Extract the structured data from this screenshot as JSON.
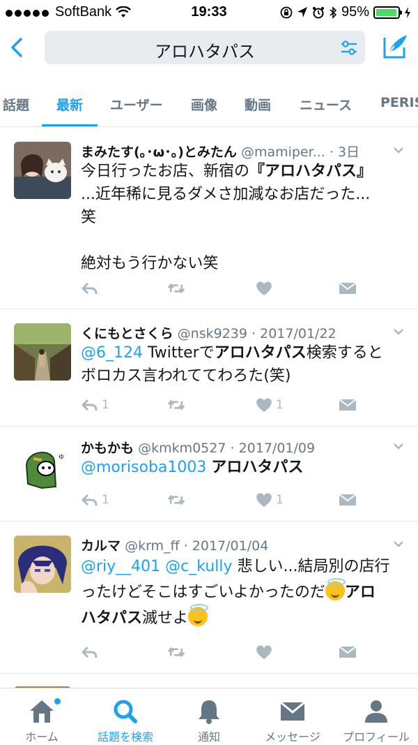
{
  "status_bar": {
    "carrier": "SoftBank",
    "time": "19:33",
    "battery": "95%",
    "battery_level": 0.95,
    "battery_color": "#4cd964"
  },
  "header": {
    "back_icon": "chevron-left-icon",
    "search_query": "アロハタパス",
    "filter_icon": "filter-sliders-icon",
    "compose_icon": "compose-tweet-icon"
  },
  "tabs": [
    {
      "label": "話題",
      "active": false
    },
    {
      "label": "最新",
      "active": true
    },
    {
      "label": "ユーザー",
      "active": false
    },
    {
      "label": "画像",
      "active": false
    },
    {
      "label": "動画",
      "active": false
    },
    {
      "label": "ニュース",
      "active": false
    },
    {
      "label": "PERIS",
      "active": false
    }
  ],
  "accent_color": "#1da1f2",
  "tweets": [
    {
      "name": "まみたす(｡･ω･｡)とみたん",
      "handle": "@mamiper...",
      "time": "· 3日",
      "text_lines": [
        "今日行ったお店、新宿の",
        "『アロハタパス』",
        "...近年稀に見るダメさ加減なお店だった...",
        "笑",
        "絶対もう行かない笑"
      ],
      "reply_count": "",
      "like_count": ""
    },
    {
      "name": "くにもとさくら",
      "handle": "@nsk9239",
      "time": "· 2017/01/22",
      "mention": "@6_124",
      "text_a": " Twitterで",
      "bold": "アロハタパス",
      "text_b": "検索すると",
      "text_line2": "ボロカス言われててわろた(笑)",
      "reply_count": "1",
      "like_count": "1"
    },
    {
      "name": "かもかも",
      "handle": "@kmkm0527",
      "time": "· 2017/01/09",
      "mention": "@morisoba1003",
      "bold": "アロハタパス",
      "reply_count": "1",
      "like_count": "1"
    },
    {
      "name": "カルマ",
      "handle": "@krm_ff",
      "time": "· 2017/01/04",
      "mention1": "@riy__401",
      "mention2": "@c_kully",
      "text_a": " 悲しい...結局別の店行",
      "text_b": "ったけどそこはすごいよかったのだ",
      "bold_a": "アロ",
      "bold_b": "ハタパス",
      "text_c": "滅せよ",
      "reply_count": "",
      "like_count": ""
    }
  ],
  "tab_bar": [
    {
      "label": "ホーム",
      "icon": "home-icon",
      "active": false
    },
    {
      "label": "話題を検索",
      "icon": "search-icon",
      "active": true
    },
    {
      "label": "通知",
      "icon": "bell-icon",
      "active": false
    },
    {
      "label": "メッセージ",
      "icon": "envelope-icon",
      "active": false
    },
    {
      "label": "プロフィール",
      "icon": "person-icon",
      "active": false
    }
  ]
}
